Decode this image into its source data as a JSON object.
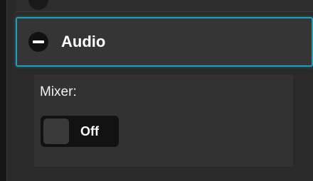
{
  "colors": {
    "background": "#151515",
    "panel": "#2a2a2a",
    "header_bg": "#353535",
    "accent_border": "#1f9dbd",
    "body_bg": "#323232",
    "toggle_bg": "#121212",
    "text": "#ffffff"
  },
  "section": {
    "title": "Audio",
    "collapse_icon": "minus-circle-icon",
    "expanded": true
  },
  "mixer": {
    "label": "Mixer:",
    "toggle_state": "Off"
  }
}
